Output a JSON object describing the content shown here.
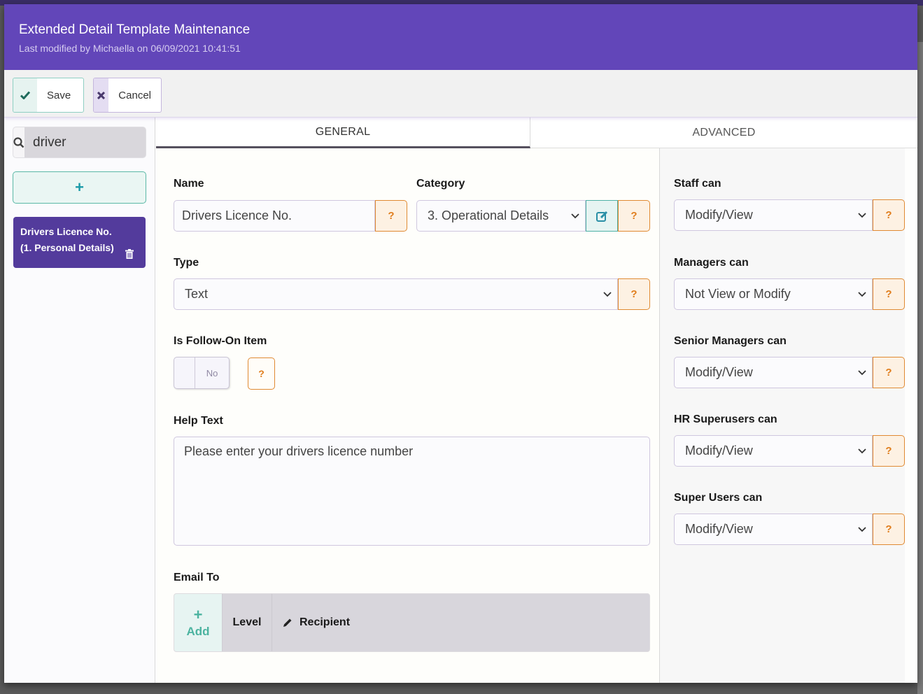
{
  "modal": {
    "title": "Extended Detail Template Maintenance",
    "subtitle": "Last modified by Michaella on 06/09/2021 10:41:51",
    "header_color": "#6246b9"
  },
  "toolbar": {
    "save_label": "Save",
    "save_icon": "check-icon",
    "cancel_label": "Cancel",
    "cancel_icon": "x-icon"
  },
  "sidebar": {
    "search_value": "driver",
    "search_placeholder": "Search",
    "add_icon": "+",
    "items": [
      {
        "line1": "Drivers Licence No.",
        "line2": "(1. Personal Details)",
        "selected": true
      }
    ]
  },
  "tabs": [
    {
      "label": "GENERAL",
      "active": true
    },
    {
      "label": "ADVANCED",
      "active": false
    }
  ],
  "general": {
    "name_label": "Name",
    "name_value": "Drivers Licence No.",
    "category_label": "Category",
    "category_value": "3. Operational Details",
    "type_label": "Type",
    "type_value": "Text",
    "follow_on_label": "Is Follow-On Item",
    "follow_on_value": "No",
    "help_text_label": "Help Text",
    "help_text_value": "Please enter your drivers licence number",
    "email_to_label": "Email To",
    "email_table": {
      "add_icon": "+",
      "add_label": "Add",
      "columns": [
        "Level",
        "Recipient"
      ]
    },
    "help_glyph": "?"
  },
  "permissions": [
    {
      "label": "Staff can",
      "value": "Modify/View"
    },
    {
      "label": "Managers can",
      "value": "Not View or Modify"
    },
    {
      "label": "Senior Managers can",
      "value": "Modify/View"
    },
    {
      "label": "HR Superusers can",
      "value": "Modify/View"
    },
    {
      "label": "Super Users can",
      "value": "Modify/View"
    }
  ]
}
